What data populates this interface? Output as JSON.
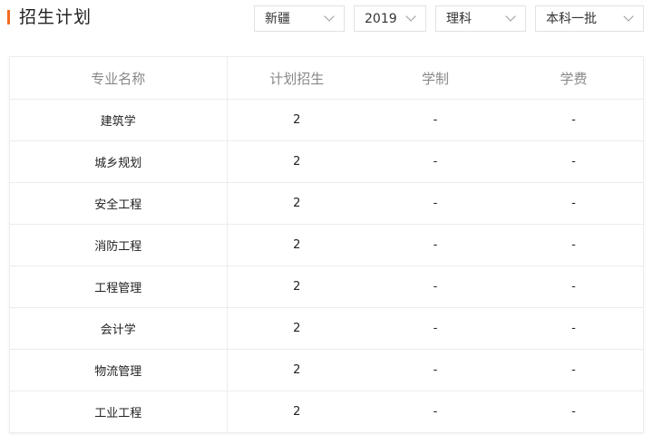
{
  "header": {
    "title": "招生计划"
  },
  "filters": {
    "province": "新疆",
    "year": "2019",
    "category": "理科",
    "batch": "本科一批"
  },
  "table": {
    "columns": [
      "专业名称",
      "计划招生",
      "学制",
      "学费"
    ],
    "rows": [
      {
        "major": "建筑学",
        "plan": "2",
        "duration": "-",
        "tuition": "-"
      },
      {
        "major": "城乡规划",
        "plan": "2",
        "duration": "-",
        "tuition": "-"
      },
      {
        "major": "安全工程",
        "plan": "2",
        "duration": "-",
        "tuition": "-"
      },
      {
        "major": "消防工程",
        "plan": "2",
        "duration": "-",
        "tuition": "-"
      },
      {
        "major": "工程管理",
        "plan": "2",
        "duration": "-",
        "tuition": "-"
      },
      {
        "major": "会计学",
        "plan": "2",
        "duration": "-",
        "tuition": "-"
      },
      {
        "major": "物流管理",
        "plan": "2",
        "duration": "-",
        "tuition": "-"
      },
      {
        "major": "工业工程",
        "plan": "2",
        "duration": "-",
        "tuition": "-"
      }
    ]
  },
  "colors": {
    "accent": "#f36c21",
    "border": "#ececec",
    "header_text": "#888888"
  },
  "icons": {
    "dropdown": "chevron-down-icon"
  }
}
